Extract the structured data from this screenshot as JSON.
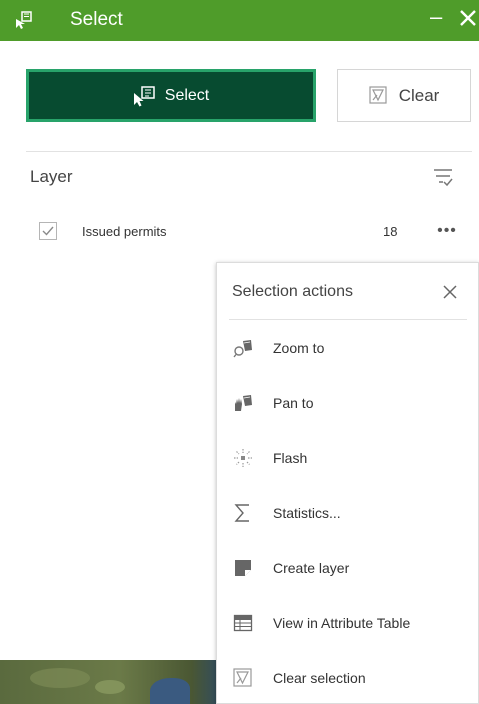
{
  "titlebar": {
    "title": "Select",
    "minimize": "–",
    "app_icon": "select-widget-icon",
    "brand_color": "#4f9c2a"
  },
  "toolbar": {
    "select_label": "Select",
    "clear_label": "Clear",
    "select_color": "#074b30"
  },
  "layers": {
    "heading": "Layer",
    "items": [
      {
        "name": "Issued permits",
        "count": "18",
        "checked": true,
        "more": "•••"
      }
    ]
  },
  "selection_actions": {
    "title": "Selection actions",
    "items": [
      {
        "label": "Zoom to",
        "icon": "zoom-to-icon"
      },
      {
        "label": "Pan to",
        "icon": "pan-to-icon"
      },
      {
        "label": "Flash",
        "icon": "flash-icon"
      },
      {
        "label": "Statistics...",
        "icon": "statistics-icon"
      },
      {
        "label": "Create layer",
        "icon": "create-layer-icon"
      },
      {
        "label": "View in Attribute Table",
        "icon": "attribute-table-icon"
      },
      {
        "label": "Clear selection",
        "icon": "clear-selection-icon"
      }
    ]
  }
}
